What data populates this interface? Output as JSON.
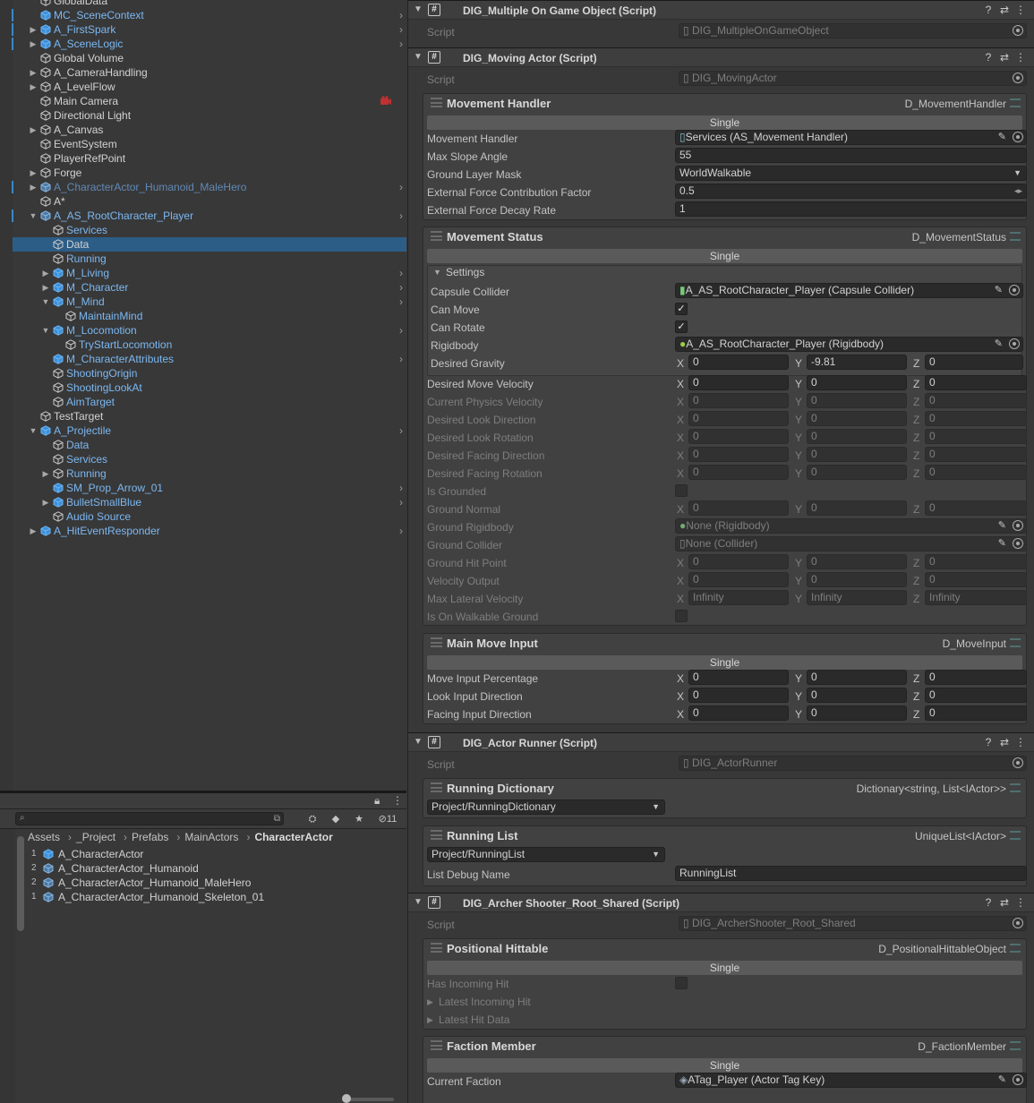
{
  "hierarchy": {
    "rows": [
      {
        "label": "GlobalData",
        "indent": 0,
        "fold": "",
        "icon": "cube-outline",
        "color": "white",
        "chev": false,
        "bar": false
      },
      {
        "label": "MC_SceneContext",
        "indent": 0,
        "fold": "",
        "icon": "cube-blue",
        "color": "blue",
        "chev": true,
        "bar": true
      },
      {
        "label": "A_FirstSpark",
        "indent": 0,
        "fold": "▶",
        "icon": "cube-blue",
        "color": "blue",
        "chev": true,
        "bar": true
      },
      {
        "label": "A_SceneLogic",
        "indent": 0,
        "fold": "▶",
        "icon": "cube-blue",
        "color": "blue",
        "chev": true,
        "bar": true
      },
      {
        "label": "Global Volume",
        "indent": 0,
        "fold": "",
        "icon": "cube-outline",
        "color": "white",
        "chev": false,
        "bar": false
      },
      {
        "label": "A_CameraHandling",
        "indent": 0,
        "fold": "▶",
        "icon": "cube-outline",
        "color": "white",
        "chev": false,
        "bar": false
      },
      {
        "label": "A_LevelFlow",
        "indent": 0,
        "fold": "▶",
        "icon": "cube-outline",
        "color": "white",
        "chev": false,
        "bar": false
      },
      {
        "label": "Main Camera",
        "indent": 0,
        "fold": "",
        "icon": "cube-outline",
        "color": "white",
        "chev": false,
        "bar": false,
        "warn": true
      },
      {
        "label": "Directional Light",
        "indent": 0,
        "fold": "",
        "icon": "cube-outline",
        "color": "white",
        "chev": false,
        "bar": false
      },
      {
        "label": "A_Canvas",
        "indent": 0,
        "fold": "▶",
        "icon": "cube-outline",
        "color": "white",
        "chev": false,
        "bar": false
      },
      {
        "label": "EventSystem",
        "indent": 0,
        "fold": "",
        "icon": "cube-outline",
        "color": "white",
        "chev": false,
        "bar": false
      },
      {
        "label": "PlayerRefPoint",
        "indent": 0,
        "fold": "",
        "icon": "cube-outline",
        "color": "white",
        "chev": false,
        "bar": false
      },
      {
        "label": "Forge",
        "indent": 0,
        "fold": "▶",
        "icon": "cube-outline",
        "color": "white",
        "chev": false,
        "bar": false
      },
      {
        "label": "A_CharacterActor_Humanoid_MaleHero",
        "indent": 0,
        "fold": "▶",
        "icon": "cube-variant",
        "color": "dim",
        "chev": true,
        "bar": true
      },
      {
        "label": "A*",
        "indent": 0,
        "fold": "",
        "icon": "cube-outline",
        "color": "white",
        "chev": false,
        "bar": false
      },
      {
        "label": "A_AS_RootCharacter_Player",
        "indent": 0,
        "fold": "▼",
        "icon": "cube-variant",
        "color": "blue",
        "chev": true,
        "bar": true
      },
      {
        "label": "Services",
        "indent": 1,
        "fold": "",
        "icon": "cube-outline",
        "color": "blue",
        "chev": false,
        "bar": false
      },
      {
        "label": "Data",
        "indent": 1,
        "fold": "",
        "icon": "cube-outline",
        "color": "white",
        "chev": false,
        "bar": false,
        "selected": true
      },
      {
        "label": "Running",
        "indent": 1,
        "fold": "",
        "icon": "cube-outline",
        "color": "blue",
        "chev": false,
        "bar": false
      },
      {
        "label": "M_Living",
        "indent": 1,
        "fold": "▶",
        "icon": "cube-blue",
        "color": "blue",
        "chev": true,
        "bar": false
      },
      {
        "label": "M_Character",
        "indent": 1,
        "fold": "▶",
        "icon": "cube-blue",
        "color": "blue",
        "chev": true,
        "bar": false
      },
      {
        "label": "M_Mind",
        "indent": 1,
        "fold": "▼",
        "icon": "cube-blue",
        "color": "blue",
        "chev": true,
        "bar": false
      },
      {
        "label": "MaintainMind",
        "indent": 2,
        "fold": "",
        "icon": "cube-outline",
        "color": "blue",
        "chev": false,
        "bar": false
      },
      {
        "label": "M_Locomotion",
        "indent": 1,
        "fold": "▼",
        "icon": "cube-blue",
        "color": "blue",
        "chev": true,
        "bar": false
      },
      {
        "label": "TryStartLocomotion",
        "indent": 2,
        "fold": "",
        "icon": "cube-outline",
        "color": "blue",
        "chev": false,
        "bar": false
      },
      {
        "label": "M_CharacterAttributes",
        "indent": 1,
        "fold": "",
        "icon": "cube-blue",
        "color": "blue",
        "chev": true,
        "bar": false
      },
      {
        "label": "ShootingOrigin",
        "indent": 1,
        "fold": "",
        "icon": "cube-outline",
        "color": "blue",
        "chev": false,
        "bar": false
      },
      {
        "label": "ShootingLookAt",
        "indent": 1,
        "fold": "",
        "icon": "cube-outline",
        "color": "blue",
        "chev": false,
        "bar": false
      },
      {
        "label": "AimTarget",
        "indent": 1,
        "fold": "",
        "icon": "cube-outline",
        "color": "blue",
        "chev": false,
        "bar": false
      },
      {
        "label": "TestTarget",
        "indent": 0,
        "fold": "",
        "icon": "cube-outline",
        "color": "white",
        "chev": false,
        "bar": false
      },
      {
        "label": "A_Projectile",
        "indent": 0,
        "fold": "▼",
        "icon": "cube-blue",
        "color": "blue",
        "chev": true,
        "bar": false
      },
      {
        "label": "Data",
        "indent": 1,
        "fold": "",
        "icon": "cube-outline",
        "color": "blue",
        "chev": false,
        "bar": false
      },
      {
        "label": "Services",
        "indent": 1,
        "fold": "",
        "icon": "cube-outline",
        "color": "blue",
        "chev": false,
        "bar": false
      },
      {
        "label": "Running",
        "indent": 1,
        "fold": "▶",
        "icon": "cube-outline",
        "color": "blue",
        "chev": false,
        "bar": false
      },
      {
        "label": "SM_Prop_Arrow_01",
        "indent": 1,
        "fold": "",
        "icon": "cube-blue",
        "color": "blue",
        "chev": true,
        "bar": false
      },
      {
        "label": "BulletSmallBlue",
        "indent": 1,
        "fold": "▶",
        "icon": "cube-blue",
        "color": "blue",
        "chev": true,
        "bar": false
      },
      {
        "label": "Audio Source",
        "indent": 1,
        "fold": "",
        "icon": "cube-outline",
        "color": "blue",
        "chev": false,
        "bar": false
      },
      {
        "label": "A_HitEventResponder",
        "indent": 0,
        "fold": "▶",
        "icon": "cube-blue",
        "color": "blue",
        "chev": true,
        "bar": false
      }
    ]
  },
  "project": {
    "search_placeholder": "",
    "hidden_count": "11",
    "breadcrumb": [
      "Assets",
      "_Project",
      "Prefabs",
      "MainActors",
      "CharacterActor"
    ],
    "files": [
      {
        "count": "1",
        "name": "A_CharacterActor",
        "icon": "cube-blue"
      },
      {
        "count": "2",
        "name": "A_CharacterActor_Humanoid",
        "icon": "cube-variant"
      },
      {
        "count": "2",
        "name": "A_CharacterActor_Humanoid_MaleHero",
        "icon": "cube-variant"
      },
      {
        "count": "1",
        "name": "A_CharacterActor_Humanoid_Skeleton_01",
        "icon": "cube-variant"
      }
    ]
  },
  "inspector": {
    "script_label": "Script",
    "single_label": "Single",
    "c1": {
      "title": "DIG_Multiple On Game Object (Script)",
      "script": "DIG_MultipleOnGameObject"
    },
    "c2": {
      "title": "DIG_Moving Actor (Script)",
      "script": "DIG_MovingActor"
    },
    "movement_handler": {
      "title": "Movement Handler",
      "type": "D_MovementHandler",
      "rows": [
        {
          "label": "Movement Handler",
          "value": "Services (AS_Movement Handler)"
        },
        {
          "label": "Max Slope Angle",
          "value": "55"
        },
        {
          "label": "Ground Layer Mask",
          "value": "WorldWalkable"
        },
        {
          "label": "External Force Contribution Factor",
          "value": "0.5"
        },
        {
          "label": "External Force Decay Rate",
          "value": "1"
        }
      ]
    },
    "movement_status": {
      "title": "Movement Status",
      "type": "D_MovementStatus",
      "settings_label": "Settings",
      "capsule_label": "Capsule Collider",
      "capsule_value": "A_AS_RootCharacter_Player (Capsule Collider)",
      "can_move_label": "Can Move",
      "can_rotate_label": "Can Rotate",
      "rigidbody_label": "Rigidbody",
      "rigidbody_value": "A_AS_RootCharacter_Player (Rigidbody)",
      "gravity_label": "Desired Gravity",
      "gravity": [
        "0",
        "-9.81",
        "0"
      ],
      "vec_rows": [
        {
          "label": "Desired Move Velocity",
          "v": [
            "0",
            "0",
            "0"
          ],
          "dis": false
        },
        {
          "label": "Current Physics Velocity",
          "v": [
            "0",
            "0",
            "0"
          ],
          "dis": true
        },
        {
          "label": "Desired Look Direction",
          "v": [
            "0",
            "0",
            "0"
          ],
          "dis": true
        },
        {
          "label": "Desired Look Rotation",
          "v": [
            "0",
            "0",
            "0"
          ],
          "dis": true
        },
        {
          "label": "Desired Facing Direction",
          "v": [
            "0",
            "0",
            "0"
          ],
          "dis": true
        },
        {
          "label": "Desired Facing Rotation",
          "v": [
            "0",
            "0",
            "0"
          ],
          "dis": true
        }
      ],
      "is_grounded_label": "Is Grounded",
      "ground_normal_label": "Ground Normal",
      "ground_normal": [
        "0",
        "0",
        "0"
      ],
      "ground_rigidbody_label": "Ground Rigidbody",
      "ground_rigidbody_value": "None (Rigidbody)",
      "ground_collider_label": "Ground Collider",
      "ground_collider_value": "None (Collider)",
      "ground_hit_label": "Ground Hit Point",
      "ground_hit": [
        "0",
        "0",
        "0"
      ],
      "vel_out_label": "Velocity Output",
      "vel_out": [
        "0",
        "0",
        "0"
      ],
      "max_lat_label": "Max Lateral Velocity",
      "max_lat": [
        "Infinity",
        "Infinity",
        "Infinity"
      ],
      "walkable_label": "Is On Walkable Ground"
    },
    "main_move": {
      "title": "Main Move Input",
      "type": "D_MoveInput",
      "rows": [
        {
          "label": "Move Input Percentage",
          "v": [
            "0",
            "0",
            "0"
          ]
        },
        {
          "label": "Look Input Direction",
          "v": [
            "0",
            "0",
            "0"
          ]
        },
        {
          "label": "Facing Input Direction",
          "v": [
            "0",
            "0",
            "0"
          ]
        }
      ]
    },
    "c3": {
      "title": "DIG_Actor Runner (Script)",
      "script": "DIG_ActorRunner"
    },
    "running_dict": {
      "title": "Running Dictionary",
      "type": "Dictionary<string, List<IActor>>",
      "value": "Project/RunningDictionary"
    },
    "running_list": {
      "title": "Running List",
      "type": "UniqueList<IActor>",
      "value": "Project/RunningList",
      "debug_label": "List Debug Name",
      "debug_value": "RunningList"
    },
    "c4": {
      "title": "DIG_Archer Shooter_Root_Shared (Script)",
      "script": "DIG_ArcherShooter_Root_Shared"
    },
    "positional": {
      "title": "Positional Hittable",
      "type": "D_PositionalHittableObject",
      "has_incoming": "Has Incoming Hit",
      "latest_incoming": "Latest Incoming Hit",
      "latest_hit": "Latest Hit Data"
    },
    "faction": {
      "title": "Faction Member",
      "type": "D_FactionMember",
      "label": "Current Faction",
      "value": "ATag_Player (Actor Tag Key)"
    },
    "axes": [
      "X",
      "Y",
      "Z"
    ]
  }
}
